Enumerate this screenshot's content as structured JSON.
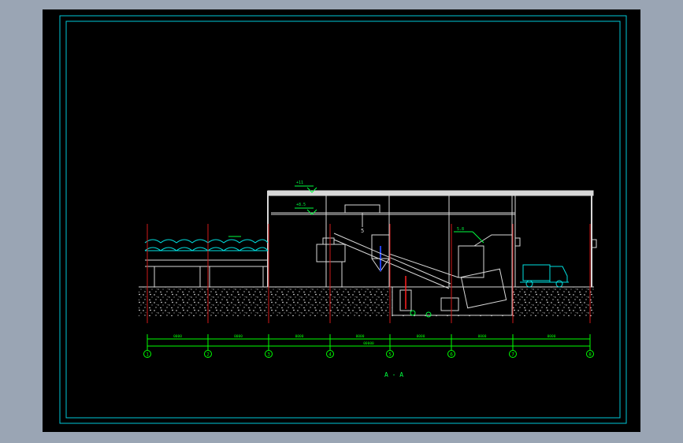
{
  "drawing": {
    "section_label": "A - A",
    "colors": {
      "frame": "#00c8d8",
      "axis": "#d01a1a",
      "structure": "#d8d8d8",
      "equipment": "#00e0e0",
      "dimension": "#00ff00",
      "annotation": "#00ff40",
      "ground": "#ffffff"
    },
    "elevations": [
      {
        "text": "+11"
      },
      {
        "text": "+8.5"
      }
    ],
    "callouts": [
      {
        "text": "5"
      },
      {
        "text": "5.8"
      }
    ],
    "dimensions": {
      "segments": [
        "0000",
        "0000",
        "0000",
        "0000",
        "0000",
        "0000",
        "0000"
      ],
      "total": "00000"
    },
    "axes": [
      {
        "label": "1"
      },
      {
        "label": "2"
      },
      {
        "label": "3"
      },
      {
        "label": "4"
      },
      {
        "label": "5"
      },
      {
        "label": "6"
      },
      {
        "label": "7"
      },
      {
        "label": "8"
      }
    ]
  }
}
